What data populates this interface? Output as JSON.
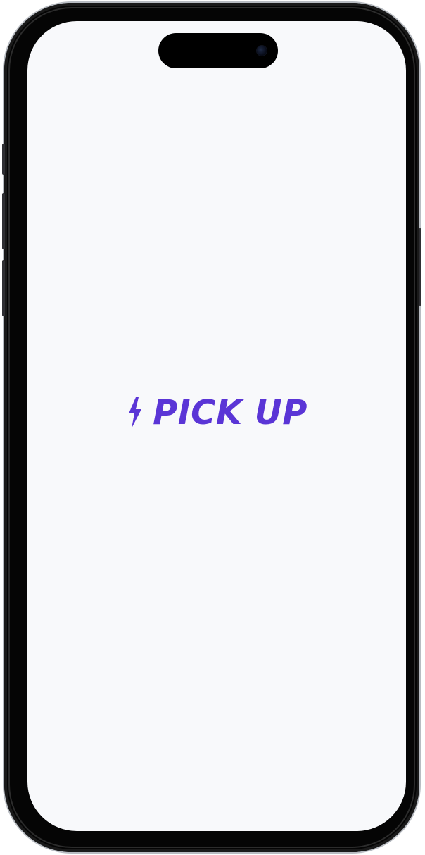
{
  "splash": {
    "brand_name": "PICK UP",
    "logo_icon": "lightning-bolt-icon"
  },
  "colors": {
    "brand_purple": "#5a35d6",
    "screen_background": "#f8f9fb",
    "device_frame": "#050505"
  }
}
